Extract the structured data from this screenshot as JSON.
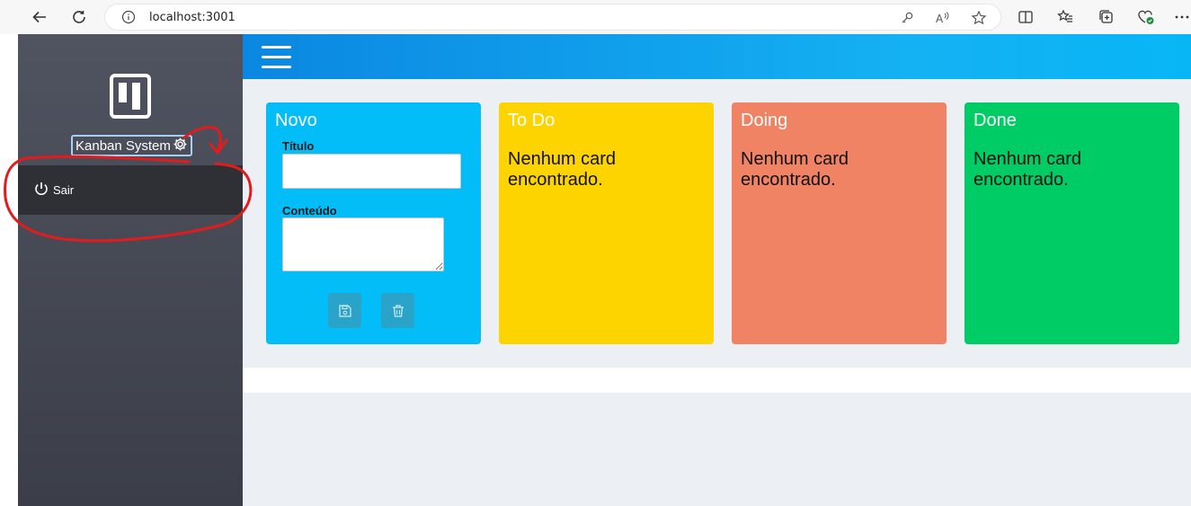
{
  "browser": {
    "url": "localhost:3001",
    "url_info_icon": "info-icon",
    "back_icon": "arrow-left-icon",
    "refresh_icon": "refresh-icon"
  },
  "sidebar": {
    "brand_label": "Kanban System",
    "menu": [
      {
        "label": "Sair",
        "icon": "power-icon"
      }
    ]
  },
  "board": {
    "columns": [
      {
        "title": "Novo",
        "color": "#03bdf9"
      },
      {
        "title": "To Do",
        "color": "#fdd400",
        "empty_message": "Nenhum card encontrado."
      },
      {
        "title": "Doing",
        "color": "#ef8364",
        "empty_message": "Nenhum card encontrado."
      },
      {
        "title": "Done",
        "color": "#00cc66",
        "empty_message": "Nenhum card encontrado."
      }
    ],
    "form": {
      "title_label": "Título",
      "title_value": "",
      "content_label": "Conteúdo",
      "content_value": ""
    }
  },
  "annotation": {
    "color": "#e21c1c"
  }
}
